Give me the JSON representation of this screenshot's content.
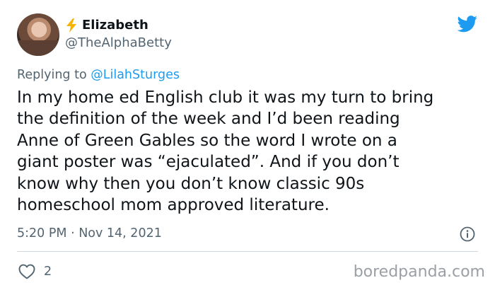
{
  "author": {
    "display_name": "Elizabeth",
    "handle": "@TheAlphaBetty",
    "avatar_icon": "profile-photo"
  },
  "reply": {
    "prefix": "Replying to ",
    "mention": "@LilahSturges"
  },
  "tweet": {
    "text": "In my home ed English club it was my turn to bring\nthe definition of the week and I’d been reading\nAnne of Green Gables so the word I wrote on a\ngiant poster was “ejaculated”. And if you don’t\nknow why then you don’t know classic 90s\nhomeschool mom approved literature.",
    "timestamp": "5:20 PM · Nov 14, 2021",
    "likes": "2"
  },
  "icons": {
    "brand": "twitter-bird-icon",
    "name_emoji": "lightning-bolt-icon",
    "info": "info-icon",
    "like": "heart-icon"
  },
  "colors": {
    "twitter_blue": "#1d9bf0",
    "secondary_text": "#536471",
    "bolt_yellow": "#f4b400"
  },
  "watermark": "boredpanda.com"
}
